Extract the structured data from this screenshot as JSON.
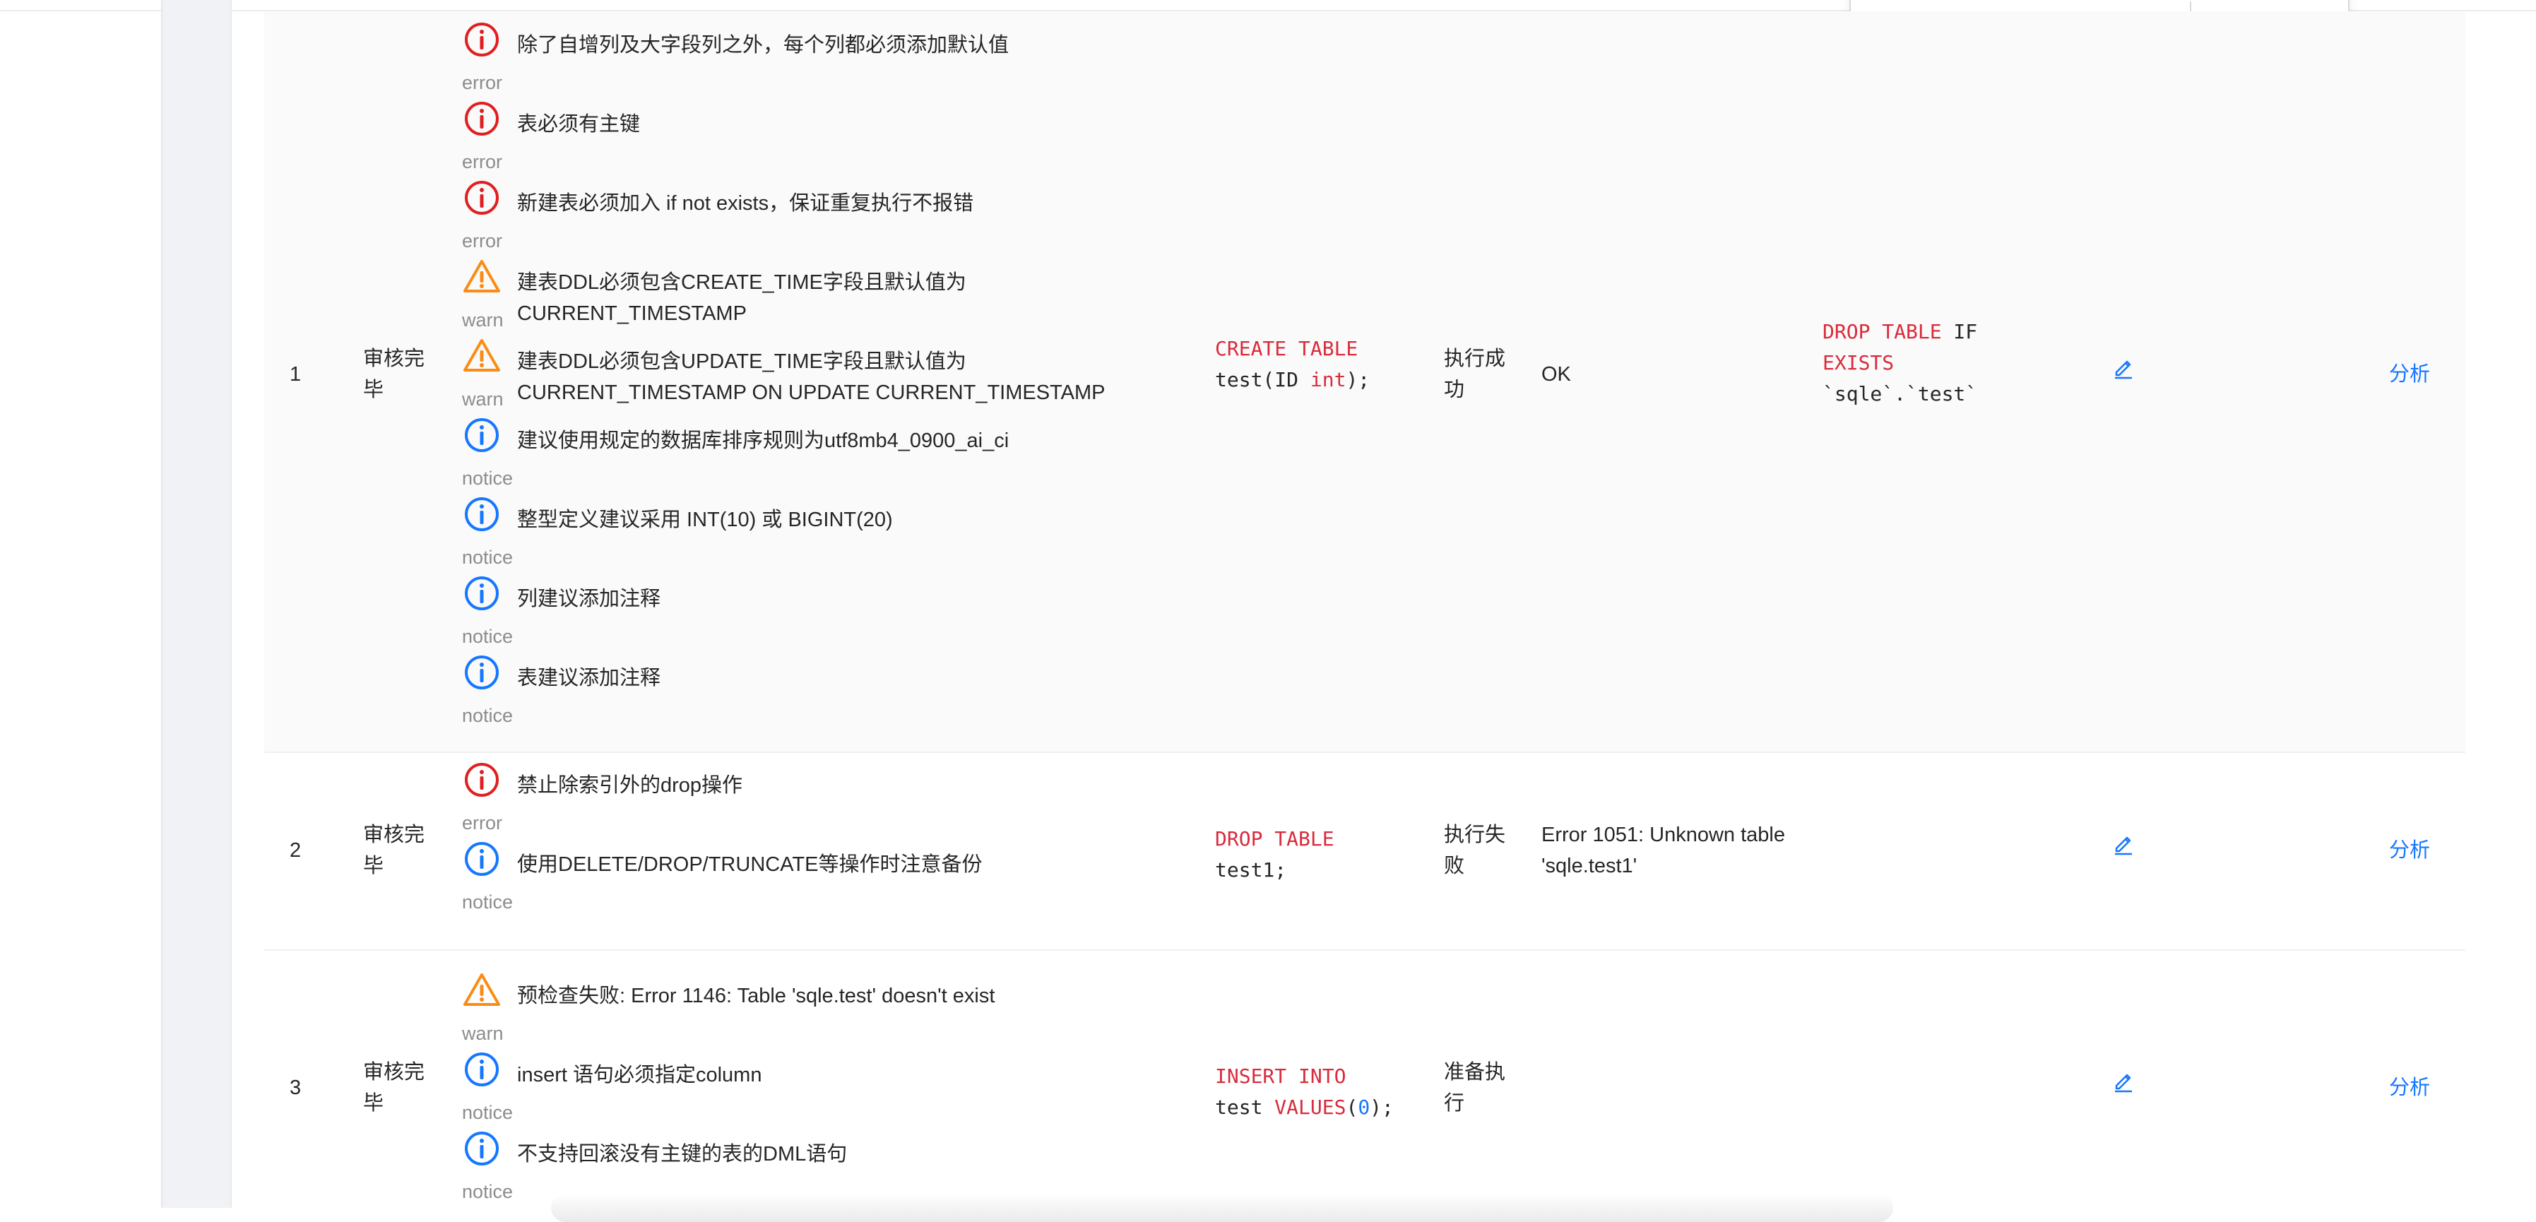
{
  "columns": [
    "index",
    "status",
    "audit_result",
    "sql",
    "exec_status",
    "exec_result",
    "rollback_sql",
    "edit",
    "analyze"
  ],
  "rows": [
    {
      "index": "1",
      "status": "审核完毕",
      "audit": [
        {
          "level": "error",
          "icon": "error-circle-icon",
          "message": "除了自增列及大字段列之外，每个列都必须添加默认值"
        },
        {
          "level": "error",
          "icon": "error-circle-icon",
          "message": "表必须有主键"
        },
        {
          "level": "error",
          "icon": "error-circle-icon",
          "message": "新建表必须加入 if not exists，保证重复执行不报错"
        },
        {
          "level": "warn",
          "icon": "warning-triangle-icon",
          "message": "建表DDL必须包含CREATE_TIME字段且默认值为 CURRENT_TIMESTAMP"
        },
        {
          "level": "warn",
          "icon": "warning-triangle-icon",
          "message": "建表DDL必须包含UPDATE_TIME字段且默认值为 CURRENT_TIMESTAMP ON UPDATE CURRENT_TIMESTAMP"
        },
        {
          "level": "notice",
          "icon": "info-circle-icon",
          "message": "建议使用规定的数据库排序规则为utf8mb4_0900_ai_ci"
        },
        {
          "level": "notice",
          "icon": "info-circle-icon",
          "message": "整型定义建议采用 INT(10) 或 BIGINT(20)"
        },
        {
          "level": "notice",
          "icon": "info-circle-icon",
          "message": "列建议添加注释"
        },
        {
          "level": "notice",
          "icon": "info-circle-icon",
          "message": "表建议添加注释"
        }
      ],
      "sql": {
        "kw1": "CREATE TABLE",
        "t1": "test(ID ",
        "kw2": "int",
        "t2": ");"
      },
      "exec_status": "执行成功",
      "exec_result": "OK",
      "rollback": {
        "kw1": "DROP TABLE",
        "t1": " IF",
        "kw2": "EXISTS",
        "t2": "`sqle`.`test`"
      },
      "analyze": "分析"
    },
    {
      "index": "2",
      "status": "审核完毕",
      "audit": [
        {
          "level": "error",
          "icon": "error-circle-icon",
          "message": "禁止除索引外的drop操作"
        },
        {
          "level": "notice",
          "icon": "info-circle-icon",
          "message": "使用DELETE/DROP/TRUNCATE等操作时注意备份"
        }
      ],
      "sql": {
        "kw1": "DROP TABLE",
        "t1": "test1;"
      },
      "exec_status": "执行失败",
      "exec_result": "Error 1051: Unknown table 'sqle.test1'",
      "analyze": "分析"
    },
    {
      "index": "3",
      "status": "审核完毕",
      "audit": [
        {
          "level": "warn",
          "icon": "warning-triangle-icon",
          "message": "预检查失败: Error 1146: Table 'sqle.test' doesn't exist"
        },
        {
          "level": "notice",
          "icon": "info-circle-icon",
          "message": "insert 语句必须指定column"
        },
        {
          "level": "notice",
          "icon": "info-circle-icon",
          "message": "不支持回滚没有主键的表的DML语句"
        }
      ],
      "sql": {
        "kw1": "INSERT INTO",
        "t1": "test ",
        "kw2": "VALUES",
        "p1": "(",
        "num": "0",
        "p2": ");"
      },
      "exec_status": "准备执行",
      "analyze": "分析"
    }
  ],
  "colors": {
    "error": "#e02020",
    "warn": "#fa8c16",
    "notice": "#1677ff",
    "keyword": "#d92b3c",
    "link": "#1677ff"
  }
}
